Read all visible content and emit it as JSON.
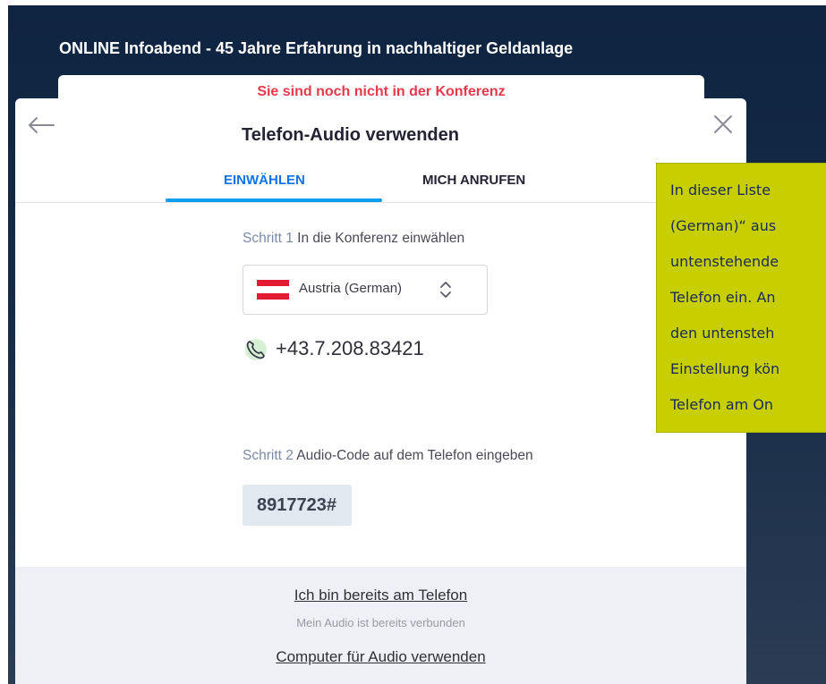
{
  "meeting": {
    "title": "ONLINE Infoabend - 45 Jahre Erfahrung in nachhaltiger Geldanlage"
  },
  "status": {
    "warning": "Sie sind noch nicht in der Konferenz"
  },
  "dialog": {
    "title": "Telefon-Audio verwenden",
    "tabs": [
      {
        "label": "EINWÄHLEN",
        "active": true
      },
      {
        "label": "MICH ANRUFEN",
        "active": false
      }
    ],
    "step1": {
      "number": "Schritt 1",
      "text": " In die Konferenz einwählen"
    },
    "country": {
      "selected": "Austria (German)",
      "flag": "austria-flag"
    },
    "phone": {
      "icon": "phone-icon",
      "number": "+43.7.208.83421"
    },
    "step2": {
      "number": "Schritt 2",
      "text": " Audio-Code auf dem Telefon eingeben"
    },
    "audio_code": "8917723#",
    "footer": {
      "already_on_phone": "Ich bin bereits am Telefon",
      "already_connected": "Mein Audio ist bereits verbunden",
      "use_computer": "Computer für Audio verwenden"
    }
  },
  "callout": {
    "lines": [
      "In dieser Liste",
      "(German)“ aus",
      "untenstehende",
      "Telefon ein. An",
      "den untensteh",
      "Einstellung kön",
      "Telefon am On"
    ]
  },
  "colors": {
    "accent": "#0e72ed",
    "warning": "#e8394a",
    "callout_bg": "#c7cf00",
    "page_bg": "#0f2440"
  }
}
